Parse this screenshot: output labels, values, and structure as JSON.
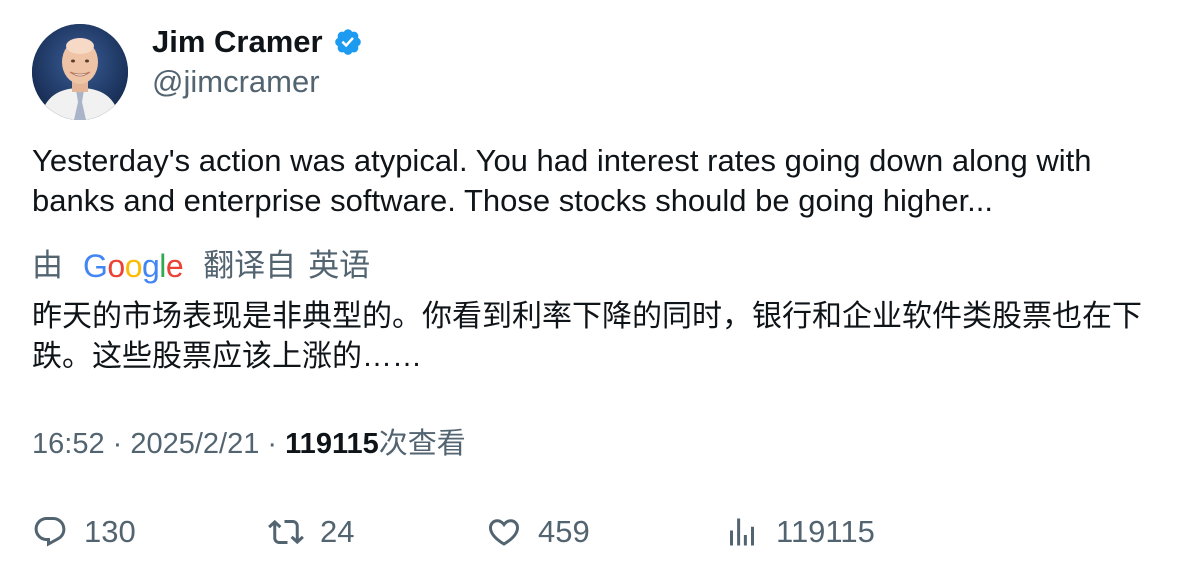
{
  "author": {
    "display_name": "Jim Cramer",
    "handle": "@jimcramer",
    "verified": true,
    "verified_color": "#1d9bf0"
  },
  "tweet": {
    "text": "Yesterday's action was atypical. You had interest rates going down along with banks and enterprise software. Those stocks should be going higher..."
  },
  "translation": {
    "prefix": "由",
    "provider": "Google",
    "suffix": "翻译自",
    "source_language": "英语",
    "text": "昨天的市场表现是非典型的。你看到利率下降的同时，银行和企业软件类股票也在下跌。这些股票应该上涨的……"
  },
  "meta": {
    "time": "16:52",
    "separator": " · ",
    "date": "2025/2/21",
    "views_count": "119115",
    "views_label": "次查看"
  },
  "actions": {
    "replies": "130",
    "retweets": "24",
    "likes": "459",
    "views": "119115"
  },
  "colors": {
    "text_primary": "#0f1419",
    "text_secondary": "#536471",
    "google_blue": "#4285f4",
    "google_red": "#ea4335",
    "google_yellow": "#fbbc05",
    "google_green": "#34a853"
  }
}
